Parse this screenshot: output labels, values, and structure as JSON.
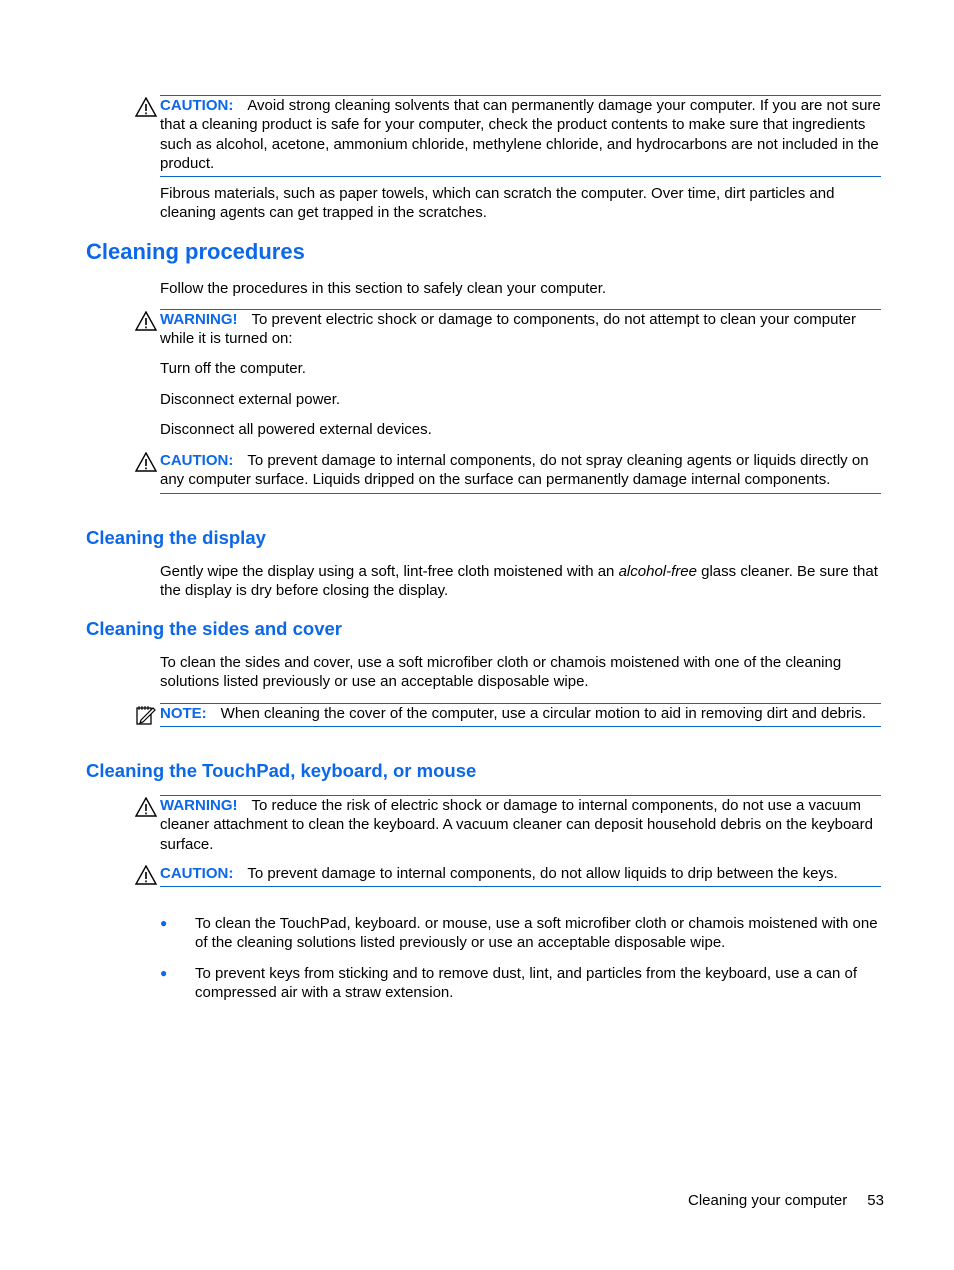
{
  "caution1": {
    "label": "CAUTION:",
    "text": "Avoid strong cleaning solvents that can permanently damage your computer. If you are not sure that a cleaning product is safe for your computer, check the product contents to make sure that ingredients such as alcohol, acetone, ammonium chloride, methylene chloride, and hydrocarbons are not included in the product."
  },
  "fibrous": "Fibrous materials, such as paper towels, which can scratch the computer. Over time, dirt particles and cleaning agents can get trapped in the scratches.",
  "procedures": {
    "heading": "Cleaning procedures",
    "intro": "Follow the procedures in this section to safely clean your computer.",
    "warning": {
      "label": "WARNING!",
      "text": "To prevent electric shock or damage to components, do not attempt to clean your computer while it is turned on:"
    },
    "steps": [
      "Turn off the computer.",
      "Disconnect external power.",
      "Disconnect all powered external devices."
    ],
    "caution": {
      "label": "CAUTION:",
      "text": "To prevent damage to internal components, do not spray cleaning agents or liquids directly on any computer surface. Liquids dripped on the surface can permanently damage internal components."
    }
  },
  "display": {
    "heading": "Cleaning the display",
    "text_before": "Gently wipe the display using a soft, lint-free cloth moistened with an ",
    "text_italic": "alcohol-free",
    "text_after": " glass cleaner. Be sure that the display is dry before closing the display."
  },
  "sides": {
    "heading": "Cleaning the sides and cover",
    "text": "To clean the sides and cover, use a soft microfiber cloth or chamois moistened with one of the cleaning solutions listed previously or use an acceptable disposable wipe.",
    "note": {
      "label": "NOTE:",
      "text": "When cleaning the cover of the computer, use a circular motion to aid in removing dirt and debris."
    }
  },
  "touchpad": {
    "heading": "Cleaning the TouchPad, keyboard, or mouse",
    "warning": {
      "label": "WARNING!",
      "text": "To reduce the risk of electric shock or damage to internal components, do not use a vacuum cleaner attachment to clean the keyboard. A vacuum cleaner can deposit household debris on the keyboard surface."
    },
    "caution": {
      "label": "CAUTION:",
      "text": "To prevent damage to internal components, do not allow liquids to drip between the keys."
    },
    "bullets": [
      "To clean the TouchPad, keyboard. or mouse, use a soft microfiber cloth or chamois moistened with one of the cleaning solutions listed previously or use an acceptable disposable wipe.",
      "To prevent keys from sticking and to remove dust, lint, and particles from the keyboard, use a can of compressed air with a straw extension."
    ]
  },
  "footer": {
    "section": "Cleaning your computer",
    "page": "53"
  }
}
